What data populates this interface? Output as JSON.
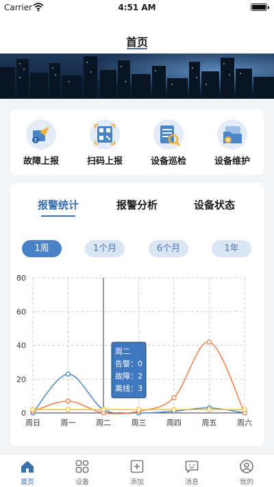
{
  "status_bar": {
    "carrier": "Carrier",
    "time": "4:51 AM"
  },
  "nav": {
    "title": "首页"
  },
  "quick_actions": [
    {
      "label": "故障上报",
      "icon": "fault-report-icon"
    },
    {
      "label": "扫码上报",
      "icon": "qr-scan-icon"
    },
    {
      "label": "设备巡检",
      "icon": "device-inspection-icon"
    },
    {
      "label": "设备维护",
      "icon": "device-maintenance-icon"
    }
  ],
  "stats": {
    "tabs": [
      "报警统计",
      "报警分析",
      "设备状态"
    ],
    "active_tab": 0,
    "periods": [
      "1周",
      "1个月",
      "6个月",
      "1年"
    ],
    "active_period": 0
  },
  "chart_data": {
    "type": "line",
    "categories": [
      "周日",
      "周一",
      "周二",
      "周三",
      "周四",
      "周五",
      "周六"
    ],
    "ylim": [
      0,
      80
    ],
    "yticks": [
      0,
      20,
      40,
      60,
      80
    ],
    "grid": true,
    "series": [
      {
        "color": "#4a86c6",
        "values": [
          0,
          23,
          2,
          0,
          1,
          3,
          0
        ]
      },
      {
        "color": "#f07c4a",
        "values": [
          1,
          7,
          0,
          1,
          9,
          42,
          0
        ]
      },
      {
        "color": "#f2c233",
        "values": [
          2,
          2,
          2,
          2,
          2,
          2,
          2
        ]
      }
    ],
    "tooltip": {
      "category_index": 2,
      "lines": [
        "周二",
        "告警：0",
        "故障：2",
        "离线：3"
      ]
    }
  },
  "tab_bar": [
    {
      "label": "首页",
      "icon": "home-icon"
    },
    {
      "label": "设备",
      "icon": "devices-grid-icon"
    },
    {
      "label": "添加",
      "icon": "add-icon"
    },
    {
      "label": "消息",
      "icon": "message-icon"
    },
    {
      "label": "我的",
      "icon": "profile-icon"
    }
  ],
  "tab_bar_active": 0
}
